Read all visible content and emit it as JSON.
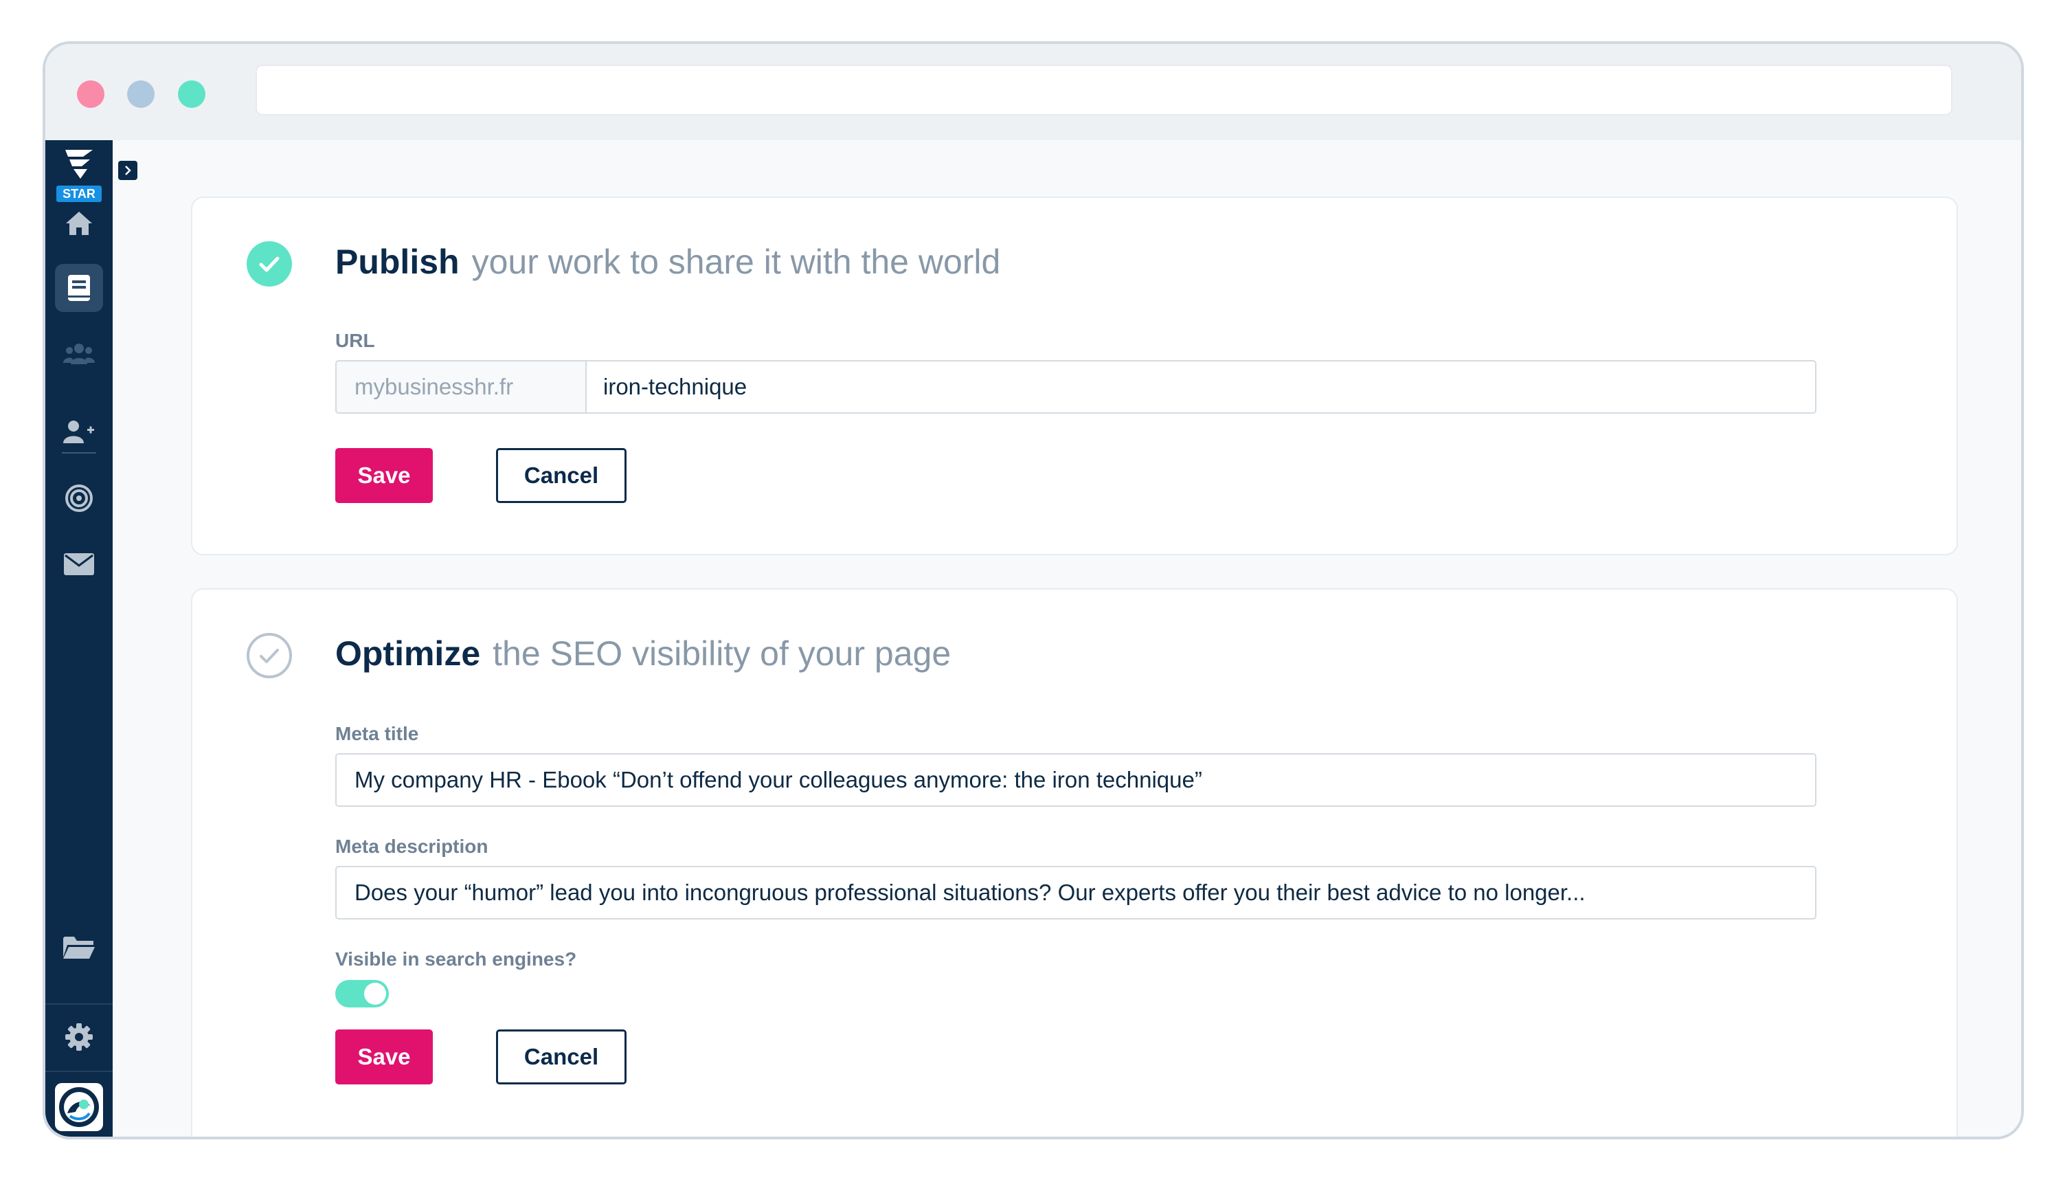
{
  "colors": {
    "accent": "#e0126e",
    "success": "#5ee3c6",
    "sidebar": "#0c2a4a",
    "dot_red": "#f98aa8",
    "dot_blue": "#aec8df",
    "dot_green": "#5ee3c6",
    "badge": "#1791e3",
    "muted_icon": "#b8c4cf"
  },
  "sidebar": {
    "logo_badge": "STAR",
    "items": [
      {
        "icon": "home-icon",
        "active": false
      },
      {
        "icon": "book-icon",
        "active": true
      },
      {
        "icon": "users-icon",
        "active": false
      },
      {
        "icon": "user-plus-icon",
        "active": false
      },
      {
        "icon": "target-icon",
        "active": false
      },
      {
        "icon": "envelope-icon",
        "active": false
      }
    ],
    "bottom_items": [
      {
        "icon": "folder-open-icon"
      },
      {
        "icon": "gear-icon"
      }
    ]
  },
  "publish": {
    "title_strong": "Publish",
    "title_rest": "your work to share it with the world",
    "completed": true,
    "url_label": "URL",
    "url_prefix": "mybusinesshr.fr",
    "url_value": "iron-technique",
    "save_label": "Save",
    "cancel_label": "Cancel"
  },
  "optimize": {
    "title_strong": "Optimize",
    "title_rest": "the SEO visibility of your page",
    "completed": false,
    "meta_title_label": "Meta title",
    "meta_title_value": "My company HR - Ebook “Don’t offend your colleagues anymore: the iron technique”",
    "meta_description_label": "Meta description",
    "meta_description_value": "Does your “humor” lead you into incongruous professional situations? Our experts offer you their best advice to no longer...",
    "visible_label": "Visible in search engines?",
    "visible_on": true,
    "save_label": "Save",
    "cancel_label": "Cancel"
  }
}
